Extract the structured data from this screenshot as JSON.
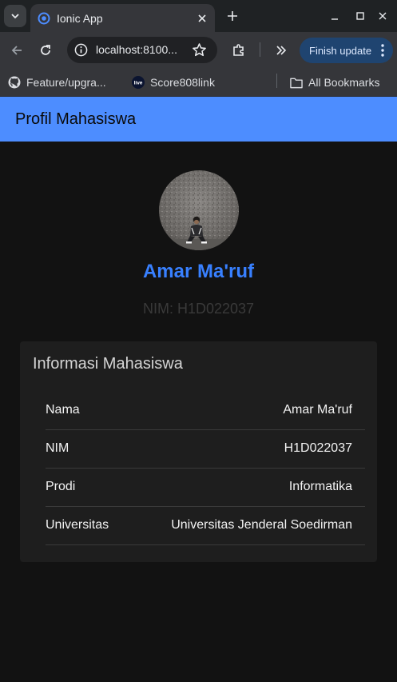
{
  "browser": {
    "tab_title": "Ionic App",
    "url": "localhost:8100...",
    "update_button": "Finish update",
    "bookmarks": [
      {
        "label": "Feature/upgra...",
        "icon": "github-icon"
      },
      {
        "label": "Score808link",
        "icon": "live-badge-icon",
        "badge_text": "live"
      }
    ],
    "all_bookmarks": "All Bookmarks"
  },
  "header": {
    "title": "Profil Mahasiswa",
    "color": "#4d8dff"
  },
  "profile": {
    "name": "Amar Ma'ruf",
    "nim_line": "NIM: H1D022037",
    "name_color": "#3880ff"
  },
  "card": {
    "title": "Informasi Mahasiswa",
    "rows": [
      {
        "label": "Nama",
        "value": "Amar Ma'ruf"
      },
      {
        "label": "NIM",
        "value": "H1D022037"
      },
      {
        "label": "Prodi",
        "value": "Informatika"
      },
      {
        "label": "Universitas",
        "value": "Universitas Jenderal Soedirman"
      }
    ]
  }
}
